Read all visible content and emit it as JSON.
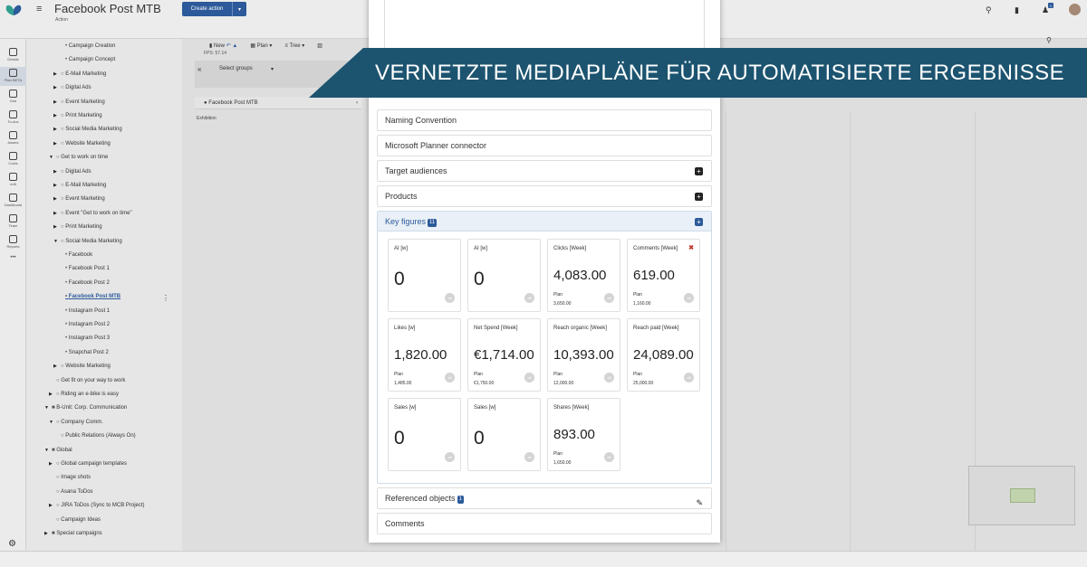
{
  "header": {
    "title": "Facebook Post MTB",
    "subtitle": "Action",
    "create_action_label": "Create action",
    "notification_count": "1"
  },
  "left_rail": [
    {
      "label": "Details",
      "icon": "warning-icon"
    },
    {
      "label": "Plan BETA",
      "icon": "calendar-icon"
    },
    {
      "label": "Grid",
      "icon": "grid-icon"
    },
    {
      "label": "To-dos",
      "icon": "checkbox-icon"
    },
    {
      "label": "Assets",
      "icon": "cloud-icon"
    },
    {
      "label": "Costs",
      "icon": "document-icon"
    },
    {
      "label": "edit",
      "icon": "users-icon"
    },
    {
      "label": "Dashboard",
      "icon": "dashboard-icon"
    },
    {
      "label": "Team",
      "icon": "team-icon"
    },
    {
      "label": "Reports",
      "icon": "reports-icon"
    },
    {
      "label": "",
      "icon": "more-icon"
    }
  ],
  "tree": [
    {
      "label": "Campaign Creation",
      "level": 3,
      "toggle": ""
    },
    {
      "label": "Campaign Concept",
      "level": 3,
      "toggle": ""
    },
    {
      "label": "E-Mail Marketing",
      "level": 2,
      "toggle": "▶"
    },
    {
      "label": "Digital Ads",
      "level": 2,
      "toggle": "▶"
    },
    {
      "label": "Event Marketing",
      "level": 2,
      "toggle": "▶"
    },
    {
      "label": "Print Marketing",
      "level": 2,
      "toggle": "▶"
    },
    {
      "label": "Social Media Marketing",
      "level": 2,
      "toggle": "▶"
    },
    {
      "label": "Website Marketing",
      "level": 2,
      "toggle": "▶"
    },
    {
      "label": "Get to work on time",
      "level": 1,
      "toggle": "▼"
    },
    {
      "label": "Digital Ads",
      "level": 2,
      "toggle": "▶"
    },
    {
      "label": "E-Mail Marketing",
      "level": 2,
      "toggle": "▶"
    },
    {
      "label": "Event Marketing",
      "level": 2,
      "toggle": "▶"
    },
    {
      "label": "Event \"Get to work on time\"",
      "level": 2,
      "toggle": "▶"
    },
    {
      "label": "Print Marketing",
      "level": 2,
      "toggle": "▶"
    },
    {
      "label": "Social Media Marketing",
      "level": 2,
      "toggle": "▼"
    },
    {
      "label": "Facebook",
      "level": 3,
      "toggle": ""
    },
    {
      "label": "Facebook Post 1",
      "level": 3,
      "toggle": ""
    },
    {
      "label": "Facebook Post 2",
      "level": 3,
      "toggle": ""
    },
    {
      "label": "Facebook Post MTB",
      "level": 3,
      "toggle": "",
      "active": true
    },
    {
      "label": "Instagram Post 1",
      "level": 3,
      "toggle": ""
    },
    {
      "label": "Instagram Post 2",
      "level": 3,
      "toggle": ""
    },
    {
      "label": "Instagram Post 3",
      "level": 3,
      "toggle": ""
    },
    {
      "label": "Snapchat Post 2",
      "level": 3,
      "toggle": ""
    },
    {
      "label": "Website Marketing",
      "level": 2,
      "toggle": "▶"
    },
    {
      "label": "Get fit on your way to work",
      "level": 1,
      "toggle": ""
    },
    {
      "label": "Riding an e-bike is easy",
      "level": 1,
      "toggle": "▶"
    },
    {
      "label": "B-Unit: Corp. Communication",
      "level": 0,
      "toggle": "▼"
    },
    {
      "label": "Company Comm.",
      "level": 1,
      "toggle": "▼"
    },
    {
      "label": "Public Relations (Always On)",
      "level": 2,
      "toggle": ""
    },
    {
      "label": "Global",
      "level": 0,
      "toggle": "▼"
    },
    {
      "label": "Global campaign templates",
      "level": 1,
      "toggle": "▶"
    },
    {
      "label": "Image shots",
      "level": 1,
      "toggle": ""
    },
    {
      "label": "Asana ToDos",
      "level": 1,
      "toggle": ""
    },
    {
      "label": "JIRA ToDos (Sync to MCB Project)",
      "level": 1,
      "toggle": "▶"
    },
    {
      "label": "Campaign Ideas",
      "level": 1,
      "toggle": ""
    },
    {
      "label": "Special campaigns",
      "level": 0,
      "toggle": "▶"
    }
  ],
  "plan": {
    "toolbar": {
      "new_label": "New",
      "plan_label": "Plan",
      "tree_label": "Tree"
    },
    "fps": "FPS: 57.14",
    "select_groups": "Select groups",
    "row_label": "Facebook Post MTB",
    "exhibition": "Exhibition"
  },
  "modal": {
    "panels": [
      {
        "label": "Naming Convention",
        "has_plus": false
      },
      {
        "label": "Microsoft Planner connector",
        "has_plus": false
      },
      {
        "label": "Target audiences",
        "has_plus": true
      },
      {
        "label": "Products",
        "has_plus": true
      }
    ],
    "key_figures": {
      "label": "Key figures",
      "count": "11",
      "cards": [
        {
          "label": "AI [w]",
          "value": "0",
          "plan_label": "",
          "plan_value": "",
          "closable": false
        },
        {
          "label": "AI [w]",
          "value": "0",
          "plan_label": "",
          "plan_value": "",
          "closable": false
        },
        {
          "label": "Clicks [Week]",
          "value": "4,083.00",
          "plan_label": "Plan",
          "plan_value": "3,650.00",
          "closable": false
        },
        {
          "label": "Comments [Week]",
          "value": "619.00",
          "plan_label": "Plan",
          "plan_value": "1,160.00",
          "closable": true
        },
        {
          "label": "Likes [w]",
          "value": "1,820.00",
          "plan_label": "Plan",
          "plan_value": "1,485.00",
          "closable": false
        },
        {
          "label": "Net Spend [Week]",
          "value": "€1,714.00",
          "plan_label": "Plan",
          "plan_value": "€1,750.00",
          "closable": false
        },
        {
          "label": "Reach organic [Week]",
          "value": "10,393.00",
          "plan_label": "Plan",
          "plan_value": "12,000.00",
          "closable": false
        },
        {
          "label": "Reach paid [Week]",
          "value": "24,089.00",
          "plan_label": "Plan",
          "plan_value": "25,000.00",
          "closable": false
        },
        {
          "label": "Sales [w]",
          "value": "0",
          "plan_label": "",
          "plan_value": "",
          "closable": false
        },
        {
          "label": "Sales [w]",
          "value": "0",
          "plan_label": "",
          "plan_value": "",
          "closable": false
        },
        {
          "label": "Shares [Week]",
          "value": "893.00",
          "plan_label": "Plan",
          "plan_value": "1,650.00",
          "closable": false
        }
      ]
    },
    "referenced_objects": {
      "label": "Referenced objects",
      "count": "1"
    },
    "comments_label": "Comments"
  },
  "banner": {
    "text": "VERNETZTE MEDIAPLÄNE FÜR AUTOMATISIERTE ERGEBNISSE"
  },
  "colors": {
    "accent": "#2c5a9a",
    "banner": "#1c5470",
    "close": "#c0392b"
  }
}
